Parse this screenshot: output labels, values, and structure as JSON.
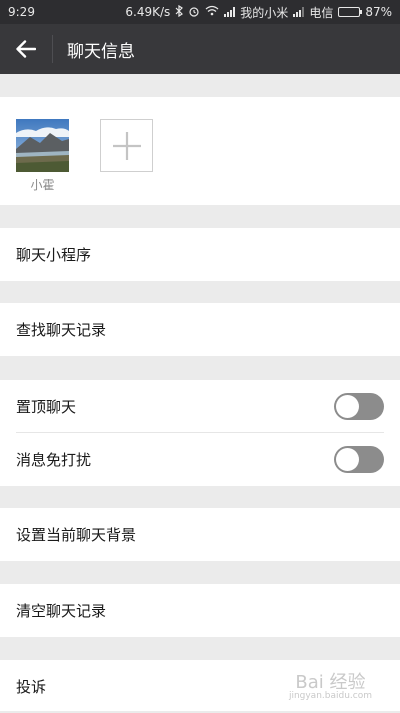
{
  "status_bar": {
    "time": "9:29",
    "network_speed": "6.49K/s",
    "carrier1": "我的小米",
    "carrier2": "电信",
    "battery": "87%",
    "battery_level": 0.87
  },
  "nav": {
    "title": "聊天信息"
  },
  "members": [
    {
      "name": "小霍"
    }
  ],
  "menu": {
    "mini_program": "聊天小程序",
    "search_history": "查找聊天记录",
    "pin_chat": "置顶聊天",
    "pin_chat_on": false,
    "mute": "消息免打扰",
    "mute_on": false,
    "set_background": "设置当前聊天背景",
    "clear_history": "清空聊天记录",
    "report": "投诉"
  },
  "watermark": {
    "text": "Bai 经验",
    "sub": "jingyan.baidu.com"
  },
  "colors": {
    "navbar": "#38383b",
    "statusbar": "#2d2d30",
    "background": "#ebebeb",
    "toggle_off": "#8c8c8c"
  }
}
